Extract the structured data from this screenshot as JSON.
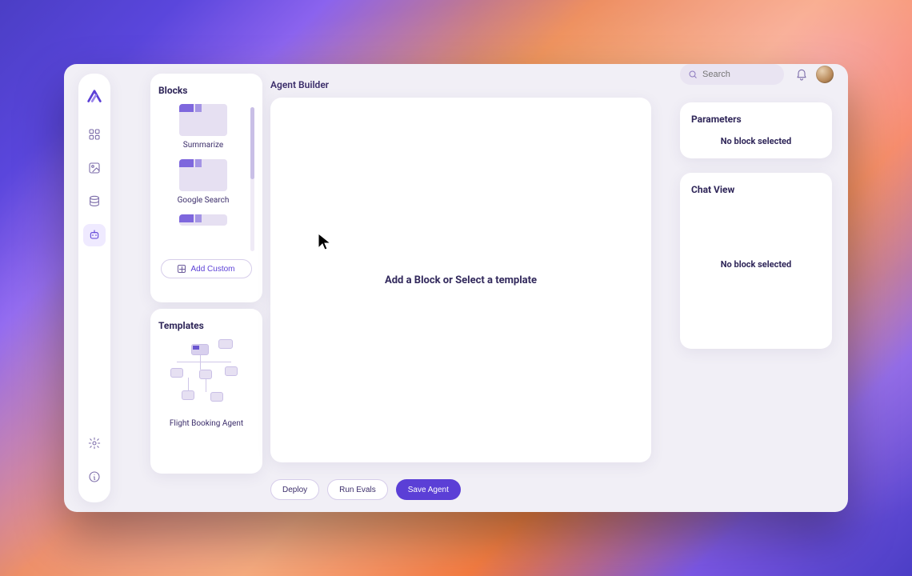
{
  "header": {
    "title": "Agent Builder",
    "search_placeholder": "Search"
  },
  "sidebar": {
    "blocks": {
      "title": "Blocks",
      "items": [
        {
          "label": "Summarize"
        },
        {
          "label": "Google Search"
        }
      ],
      "add_custom_label": "Add Custom"
    },
    "templates": {
      "title": "Templates",
      "items": [
        {
          "label": "Flight Booking Agent"
        }
      ]
    }
  },
  "canvas": {
    "empty_text": "Add a Block or Select a template"
  },
  "right": {
    "parameters": {
      "title": "Parameters",
      "empty": "No block selected"
    },
    "chat": {
      "title": "Chat View",
      "empty": "No block selected"
    }
  },
  "actions": {
    "deploy": "Deploy",
    "run_evals": "Run Evals",
    "save_agent": "Save Agent"
  },
  "colors": {
    "accent": "#5b3fd6",
    "text": "#2e2558"
  }
}
